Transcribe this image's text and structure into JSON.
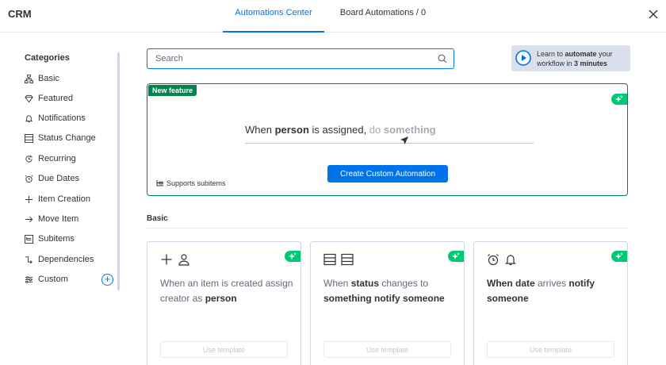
{
  "app": {
    "title": "CRM"
  },
  "tabs": [
    {
      "label": "Automations Center",
      "active": true
    },
    {
      "label": "Board Automations / 0",
      "active": false
    }
  ],
  "sidebar": {
    "title": "Categories",
    "items": [
      {
        "label": "Basic",
        "icon": "sitemap-icon"
      },
      {
        "label": "Featured",
        "icon": "diamond-icon"
      },
      {
        "label": "Notifications",
        "icon": "bell-icon"
      },
      {
        "label": "Status Change",
        "icon": "status-list-icon"
      },
      {
        "label": "Recurring",
        "icon": "recurring-icon"
      },
      {
        "label": "Due Dates",
        "icon": "alarm-clock-icon"
      },
      {
        "label": "Item Creation",
        "icon": "plus-icon"
      },
      {
        "label": "Move Item",
        "icon": "arrow-right-icon"
      },
      {
        "label": "Subitems",
        "icon": "subitems-icon"
      },
      {
        "label": "Dependencies",
        "icon": "dependency-icon"
      },
      {
        "label": "Custom",
        "icon": "sliders-icon"
      }
    ],
    "add_custom": "+"
  },
  "search": {
    "placeholder": "Search",
    "value": ""
  },
  "learn": {
    "prefix": "Learn to ",
    "bold1": "automate",
    "mid": " your workflow in ",
    "bold2": "3 minutes"
  },
  "feature": {
    "badge": "New feature",
    "sentence": {
      "w1": "When ",
      "b1": "person",
      "w2": " is assigned, ",
      "m1": "do ",
      "m2": "something"
    },
    "button": "Create Custom Automation",
    "note": "Supports subitems"
  },
  "section": {
    "title": "Basic"
  },
  "cards": [
    {
      "parts": [
        "When an item is created assign creator as ",
        "person"
      ],
      "button": "Use template"
    },
    {
      "parts": [
        "When ",
        "status",
        " changes to ",
        "something",
        " ",
        "notify",
        " ",
        "someone"
      ],
      "button": "Use template"
    },
    {
      "parts": [
        "When date",
        " arrives ",
        "notify",
        " ",
        "someone"
      ],
      "button": "Use template"
    }
  ],
  "colors": {
    "accent": "#0073ea",
    "feature_border": "#00854d",
    "ai_badge": "#00c875"
  }
}
